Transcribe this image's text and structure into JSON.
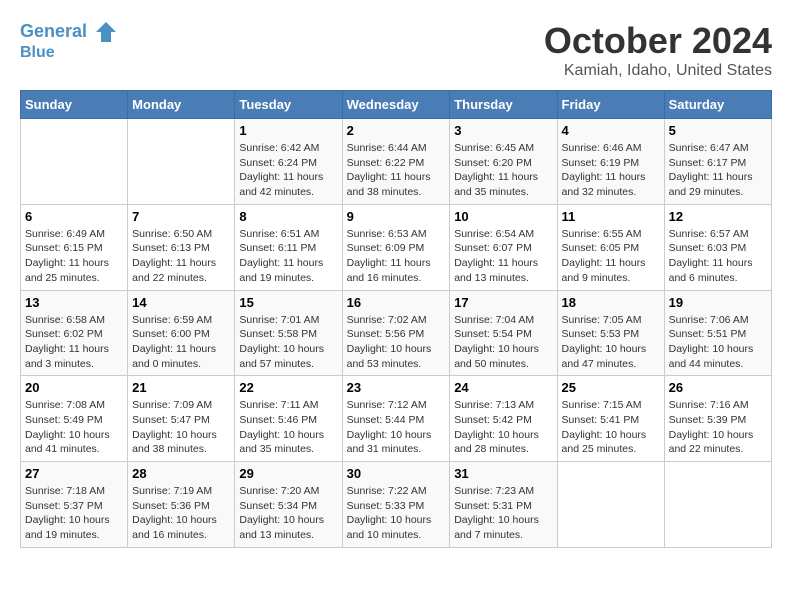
{
  "header": {
    "logo_line1": "General",
    "logo_line2": "Blue",
    "month": "October 2024",
    "location": "Kamiah, Idaho, United States"
  },
  "weekdays": [
    "Sunday",
    "Monday",
    "Tuesday",
    "Wednesday",
    "Thursday",
    "Friday",
    "Saturday"
  ],
  "weeks": [
    [
      {
        "day": "",
        "sunrise": "",
        "sunset": "",
        "daylight": ""
      },
      {
        "day": "",
        "sunrise": "",
        "sunset": "",
        "daylight": ""
      },
      {
        "day": "1",
        "sunrise": "Sunrise: 6:42 AM",
        "sunset": "Sunset: 6:24 PM",
        "daylight": "Daylight: 11 hours and 42 minutes."
      },
      {
        "day": "2",
        "sunrise": "Sunrise: 6:44 AM",
        "sunset": "Sunset: 6:22 PM",
        "daylight": "Daylight: 11 hours and 38 minutes."
      },
      {
        "day": "3",
        "sunrise": "Sunrise: 6:45 AM",
        "sunset": "Sunset: 6:20 PM",
        "daylight": "Daylight: 11 hours and 35 minutes."
      },
      {
        "day": "4",
        "sunrise": "Sunrise: 6:46 AM",
        "sunset": "Sunset: 6:19 PM",
        "daylight": "Daylight: 11 hours and 32 minutes."
      },
      {
        "day": "5",
        "sunrise": "Sunrise: 6:47 AM",
        "sunset": "Sunset: 6:17 PM",
        "daylight": "Daylight: 11 hours and 29 minutes."
      }
    ],
    [
      {
        "day": "6",
        "sunrise": "Sunrise: 6:49 AM",
        "sunset": "Sunset: 6:15 PM",
        "daylight": "Daylight: 11 hours and 25 minutes."
      },
      {
        "day": "7",
        "sunrise": "Sunrise: 6:50 AM",
        "sunset": "Sunset: 6:13 PM",
        "daylight": "Daylight: 11 hours and 22 minutes."
      },
      {
        "day": "8",
        "sunrise": "Sunrise: 6:51 AM",
        "sunset": "Sunset: 6:11 PM",
        "daylight": "Daylight: 11 hours and 19 minutes."
      },
      {
        "day": "9",
        "sunrise": "Sunrise: 6:53 AM",
        "sunset": "Sunset: 6:09 PM",
        "daylight": "Daylight: 11 hours and 16 minutes."
      },
      {
        "day": "10",
        "sunrise": "Sunrise: 6:54 AM",
        "sunset": "Sunset: 6:07 PM",
        "daylight": "Daylight: 11 hours and 13 minutes."
      },
      {
        "day": "11",
        "sunrise": "Sunrise: 6:55 AM",
        "sunset": "Sunset: 6:05 PM",
        "daylight": "Daylight: 11 hours and 9 minutes."
      },
      {
        "day": "12",
        "sunrise": "Sunrise: 6:57 AM",
        "sunset": "Sunset: 6:03 PM",
        "daylight": "Daylight: 11 hours and 6 minutes."
      }
    ],
    [
      {
        "day": "13",
        "sunrise": "Sunrise: 6:58 AM",
        "sunset": "Sunset: 6:02 PM",
        "daylight": "Daylight: 11 hours and 3 minutes."
      },
      {
        "day": "14",
        "sunrise": "Sunrise: 6:59 AM",
        "sunset": "Sunset: 6:00 PM",
        "daylight": "Daylight: 11 hours and 0 minutes."
      },
      {
        "day": "15",
        "sunrise": "Sunrise: 7:01 AM",
        "sunset": "Sunset: 5:58 PM",
        "daylight": "Daylight: 10 hours and 57 minutes."
      },
      {
        "day": "16",
        "sunrise": "Sunrise: 7:02 AM",
        "sunset": "Sunset: 5:56 PM",
        "daylight": "Daylight: 10 hours and 53 minutes."
      },
      {
        "day": "17",
        "sunrise": "Sunrise: 7:04 AM",
        "sunset": "Sunset: 5:54 PM",
        "daylight": "Daylight: 10 hours and 50 minutes."
      },
      {
        "day": "18",
        "sunrise": "Sunrise: 7:05 AM",
        "sunset": "Sunset: 5:53 PM",
        "daylight": "Daylight: 10 hours and 47 minutes."
      },
      {
        "day": "19",
        "sunrise": "Sunrise: 7:06 AM",
        "sunset": "Sunset: 5:51 PM",
        "daylight": "Daylight: 10 hours and 44 minutes."
      }
    ],
    [
      {
        "day": "20",
        "sunrise": "Sunrise: 7:08 AM",
        "sunset": "Sunset: 5:49 PM",
        "daylight": "Daylight: 10 hours and 41 minutes."
      },
      {
        "day": "21",
        "sunrise": "Sunrise: 7:09 AM",
        "sunset": "Sunset: 5:47 PM",
        "daylight": "Daylight: 10 hours and 38 minutes."
      },
      {
        "day": "22",
        "sunrise": "Sunrise: 7:11 AM",
        "sunset": "Sunset: 5:46 PM",
        "daylight": "Daylight: 10 hours and 35 minutes."
      },
      {
        "day": "23",
        "sunrise": "Sunrise: 7:12 AM",
        "sunset": "Sunset: 5:44 PM",
        "daylight": "Daylight: 10 hours and 31 minutes."
      },
      {
        "day": "24",
        "sunrise": "Sunrise: 7:13 AM",
        "sunset": "Sunset: 5:42 PM",
        "daylight": "Daylight: 10 hours and 28 minutes."
      },
      {
        "day": "25",
        "sunrise": "Sunrise: 7:15 AM",
        "sunset": "Sunset: 5:41 PM",
        "daylight": "Daylight: 10 hours and 25 minutes."
      },
      {
        "day": "26",
        "sunrise": "Sunrise: 7:16 AM",
        "sunset": "Sunset: 5:39 PM",
        "daylight": "Daylight: 10 hours and 22 minutes."
      }
    ],
    [
      {
        "day": "27",
        "sunrise": "Sunrise: 7:18 AM",
        "sunset": "Sunset: 5:37 PM",
        "daylight": "Daylight: 10 hours and 19 minutes."
      },
      {
        "day": "28",
        "sunrise": "Sunrise: 7:19 AM",
        "sunset": "Sunset: 5:36 PM",
        "daylight": "Daylight: 10 hours and 16 minutes."
      },
      {
        "day": "29",
        "sunrise": "Sunrise: 7:20 AM",
        "sunset": "Sunset: 5:34 PM",
        "daylight": "Daylight: 10 hours and 13 minutes."
      },
      {
        "day": "30",
        "sunrise": "Sunrise: 7:22 AM",
        "sunset": "Sunset: 5:33 PM",
        "daylight": "Daylight: 10 hours and 10 minutes."
      },
      {
        "day": "31",
        "sunrise": "Sunrise: 7:23 AM",
        "sunset": "Sunset: 5:31 PM",
        "daylight": "Daylight: 10 hours and 7 minutes."
      },
      {
        "day": "",
        "sunrise": "",
        "sunset": "",
        "daylight": ""
      },
      {
        "day": "",
        "sunrise": "",
        "sunset": "",
        "daylight": ""
      }
    ]
  ]
}
